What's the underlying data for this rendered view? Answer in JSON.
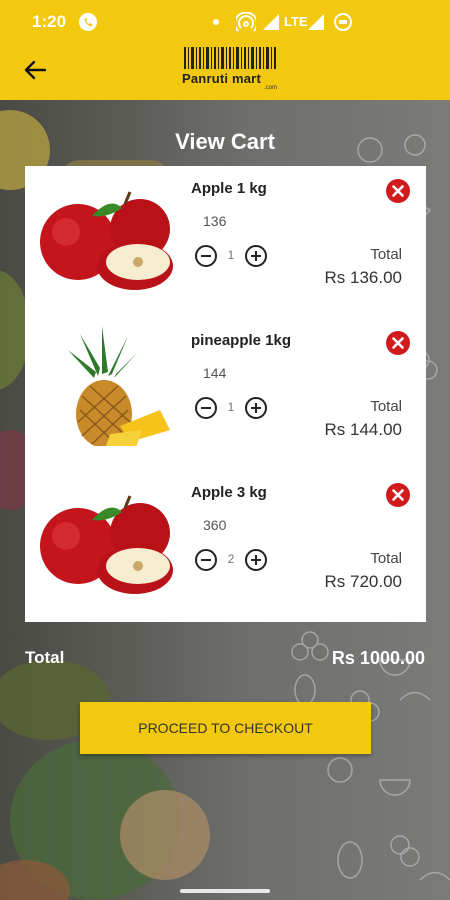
{
  "status_bar": {
    "time": "1:20",
    "network": "LTE"
  },
  "app_bar": {
    "back_icon": "arrow-left-icon",
    "logo_text": "Panruti mart",
    "logo_sub": ".com"
  },
  "page": {
    "title": "View Cart"
  },
  "cart": {
    "items": [
      {
        "name": "Apple 1 kg",
        "price": "136",
        "qty": "1",
        "total_label": "Total",
        "total": "Rs 136.00",
        "image": "apple-image"
      },
      {
        "name": "pineapple 1kg",
        "price": "144",
        "qty": "1",
        "total_label": "Total",
        "total": "Rs 144.00",
        "image": "pineapple-image"
      },
      {
        "name": "Apple 3 kg",
        "price": "360",
        "qty": "2",
        "total_label": "Total",
        "total": "Rs 720.00",
        "image": "apple-image"
      }
    ]
  },
  "summary": {
    "label": "Total",
    "value": "Rs 1000.00"
  },
  "checkout": {
    "label": "PROCEED TO CHECKOUT"
  },
  "colors": {
    "accent": "#f3c90f",
    "remove": "#d11a1a"
  }
}
